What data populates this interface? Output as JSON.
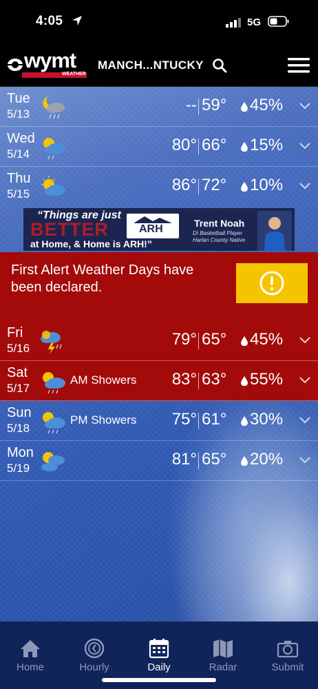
{
  "status_bar": {
    "time": "4:05",
    "network": "5G"
  },
  "header": {
    "logo_text": "wymt",
    "logo_sub": "WEATHER",
    "location": "MANCH...NTUCKY",
    "icons": [
      "search-icon",
      "hamburger-menu-icon"
    ]
  },
  "forecast_top": [
    {
      "day": "Tue",
      "date": "5/13",
      "icon": "night-cloudy-rain",
      "condition": "",
      "high": "--",
      "low": "59°",
      "precip": "45%"
    },
    {
      "day": "Wed",
      "date": "5/14",
      "icon": "partly-sunny-rain",
      "condition": "",
      "high": "80°",
      "low": "66°",
      "precip": "15%"
    },
    {
      "day": "Thu",
      "date": "5/15",
      "icon": "partly-sunny",
      "condition": "",
      "high": "86°",
      "low": "72°",
      "precip": "10%"
    }
  ],
  "ad": {
    "line1": "“Things are just",
    "line2": "BETTER",
    "line3": "at Home, & Home is ARH!”",
    "brand": "ARH",
    "name": "Trent Noah",
    "sub1": "DI Basketball Player",
    "sub2": "Harlan County Native"
  },
  "alert_banner": {
    "message": "First Alert Weather Days have been declared.",
    "icon": "warning-icon",
    "color": "#a30b0b",
    "accent": "#f5c400"
  },
  "forecast_bottom": [
    {
      "day": "Fri",
      "date": "5/16",
      "icon": "thunderstorm",
      "condition": "",
      "high": "79°",
      "low": "65°",
      "precip": "45%",
      "alert": true
    },
    {
      "day": "Sat",
      "date": "5/17",
      "icon": "partly-sunny-rain",
      "condition": "AM Showers",
      "high": "83°",
      "low": "63°",
      "precip": "55%",
      "alert": true
    },
    {
      "day": "Sun",
      "date": "5/18",
      "icon": "partly-sunny-rain",
      "condition": "PM Showers",
      "high": "75°",
      "low": "61°",
      "precip": "30%",
      "alert": false
    },
    {
      "day": "Mon",
      "date": "5/19",
      "icon": "partly-sunny-clouds",
      "condition": "",
      "high": "81°",
      "low": "65°",
      "precip": "20%",
      "alert": false
    }
  ],
  "tabs": [
    {
      "label": "Home",
      "icon": "home-icon",
      "active": false
    },
    {
      "label": "Hourly",
      "icon": "clock-icon",
      "active": false
    },
    {
      "label": "Daily",
      "icon": "calendar-icon",
      "active": true
    },
    {
      "label": "Radar",
      "icon": "map-icon",
      "active": false
    },
    {
      "label": "Submit",
      "icon": "camera-icon",
      "active": false
    }
  ]
}
